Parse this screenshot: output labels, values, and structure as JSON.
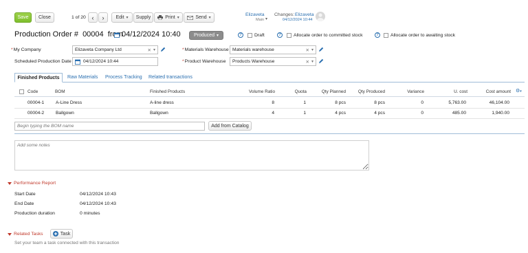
{
  "toolbar": {
    "save": "Save",
    "close": "Close",
    "pager": "1 of 20",
    "edit": "Edit",
    "supply": "Supply",
    "print": "Print",
    "send": "Send"
  },
  "user": {
    "name": "Elizaveta",
    "role": "Main"
  },
  "changes": {
    "label": "Changes:",
    "user": "Elizaveta",
    "timestamp": "04/12/2024 10:44"
  },
  "header": {
    "title_prefix": "Production Order #",
    "number": "00004",
    "from_label": "from",
    "date": "04/12/2024 10:40",
    "status": "Produced",
    "draft_label": "Draft",
    "allocate_committed_label": "Allocate order to committed stock",
    "allocate_awaiting_label": "Allocate order to awaiting stock"
  },
  "form": {
    "my_company_label": "My Company",
    "my_company_value": "Elizaveta Company Ltd",
    "scheduled_date_label": "Scheduled Production Date",
    "scheduled_date_value": "04/12/2024 10:44",
    "materials_warehouse_label": "Materials Warehouse",
    "materials_warehouse_value": "Materials warehouse",
    "product_warehouse_label": "Product Warehouse",
    "product_warehouse_value": "Products Warehouse"
  },
  "tabs": [
    "Finished Products",
    "Raw Materials",
    "Process Tracking",
    "Related transactions"
  ],
  "table": {
    "headers": {
      "code": "Code",
      "bom": "BOM",
      "finished": "Finished Products",
      "volume_ratio": "Volume Ratio",
      "quota": "Quota",
      "qty_planned": "Qty Planned",
      "qty_produced": "Qty Produced",
      "variance": "Variance",
      "unit_cost": "U. cost",
      "cost_amount": "Cost amount"
    },
    "rows": [
      {
        "code": "00004-1",
        "bom": "A-Line Dress",
        "finished": "A-line dress",
        "volume_ratio": "8",
        "quota": "1",
        "qty_planned": "8 pcs",
        "qty_produced": "8 pcs",
        "variance": "0",
        "unit_cost": "5,763.00",
        "cost_amount": "46,104.00"
      },
      {
        "code": "00004-2",
        "bom": "Ballgown",
        "finished": "Ballgown",
        "volume_ratio": "4",
        "quota": "1",
        "qty_planned": "4 pcs",
        "qty_produced": "4 pcs",
        "variance": "0",
        "unit_cost": "485.00",
        "cost_amount": "1,940.00"
      }
    ]
  },
  "bom_input_placeholder": "Begin typing the BOM name",
  "add_from_catalog": "Add from Catalog",
  "notes_placeholder": "Add some notes",
  "performance": {
    "title": "Performance Report",
    "start_date_label": "Start Date",
    "start_date_value": "04/12/2024 10:43",
    "end_date_label": "End Date",
    "end_date_value": "04/12/2024 10:43",
    "duration_label": "Production duration",
    "duration_value": "0 minutes"
  },
  "related_tasks": {
    "title": "Related Tasks",
    "task_button": "Task",
    "hint": "Set your team a task connected with this transaction"
  }
}
